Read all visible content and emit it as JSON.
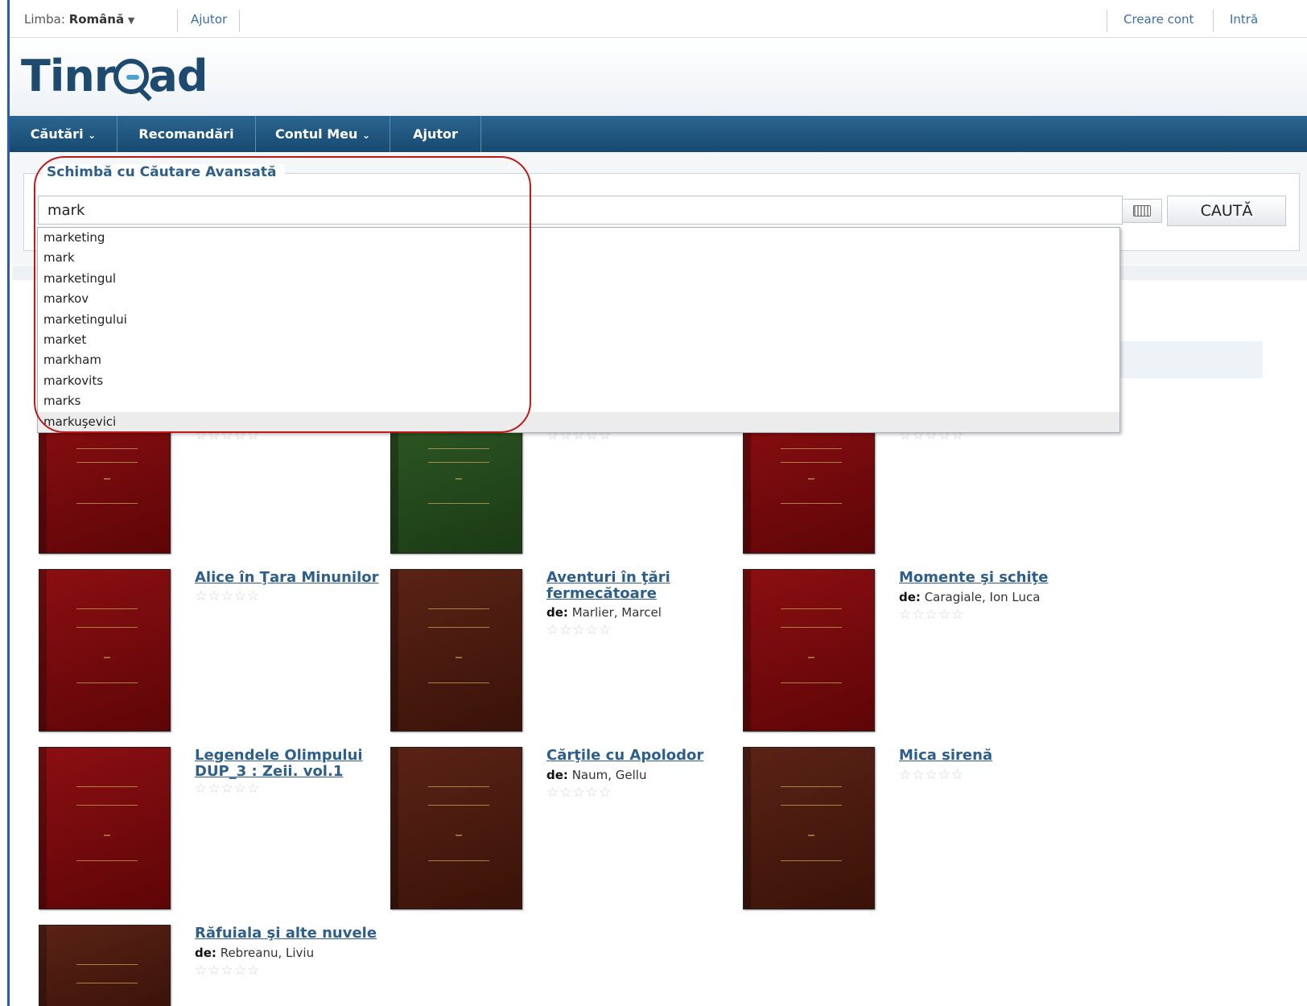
{
  "topbar": {
    "lang_label": "Limba:",
    "lang_value": "Română",
    "lang_caret": "▼",
    "help": "Ajutor",
    "create_account": "Creare cont",
    "login": "Intră"
  },
  "logo": {
    "pre": "Tinr",
    "post": "ad"
  },
  "nav": {
    "searches": "Căutări",
    "recommendations": "Recomandări",
    "my_account": "Contul Meu",
    "help": "Ajutor",
    "caret": "⌄"
  },
  "search": {
    "legend": "Schimbă cu  Căutare Avansată",
    "value": "mark",
    "button": "CAUTĂ"
  },
  "autocomplete": [
    "marketing",
    "mark",
    "marketingul",
    "markov",
    "marketingului",
    "market",
    "markham",
    "markovits",
    "marks",
    "markuşevici"
  ],
  "books": {
    "author_prefix": "de:",
    "stars": "☆☆☆☆☆",
    "b1": {
      "title": "Alice în Ţara Minunilor"
    },
    "b2": {
      "title_l1": "Aventuri în ţări",
      "title_l2": "fermecătoare",
      "author": "Marlier, Marcel"
    },
    "b3": {
      "title": "Momente şi schiţe",
      "author": "Caragiale, Ion Luca"
    },
    "b4": {
      "title_l1": "Legendele Olimpului",
      "title_l2": "DUP_3 : Zeii. vol.1"
    },
    "b5": {
      "title": "Cărţile cu Apolodor",
      "author": "Naum, Gellu"
    },
    "b6": {
      "title": "Mica sirenă"
    },
    "b7": {
      "title": "Răfuiala şi alte nuvele",
      "author": "Rebreanu, Liviu"
    }
  }
}
